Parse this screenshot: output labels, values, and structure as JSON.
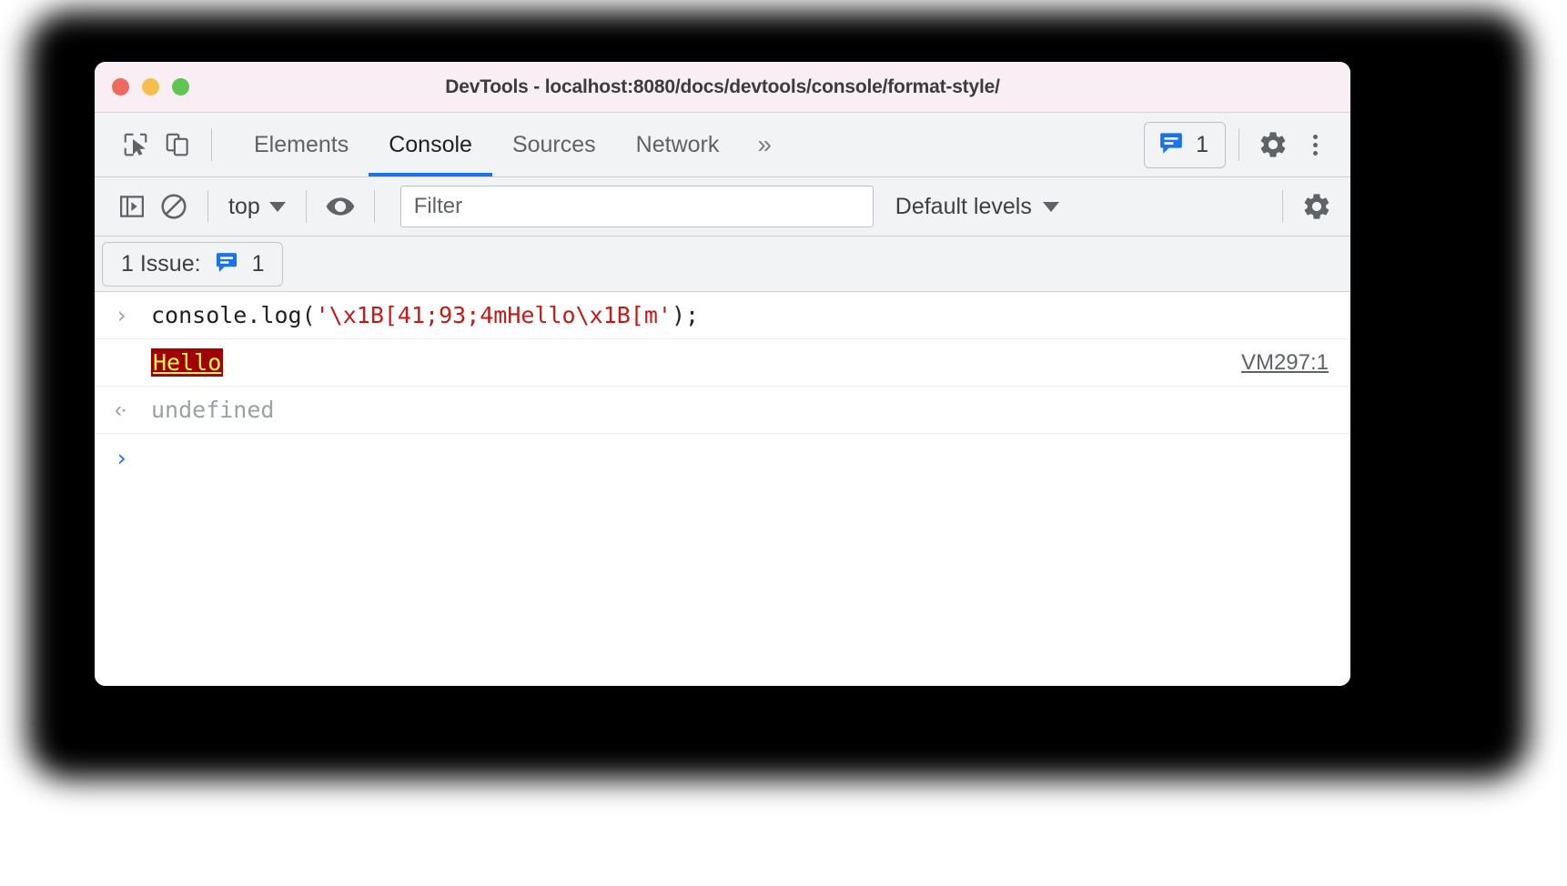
{
  "window": {
    "title": "DevTools - localhost:8080/docs/devtools/console/format-style/",
    "traffic_lights": [
      "close",
      "minimize",
      "zoom"
    ]
  },
  "tabbar": {
    "inspect_icon": "inspect-element-icon",
    "device_icon": "device-toolbar-icon",
    "tabs": [
      {
        "label": "Elements",
        "active": false
      },
      {
        "label": "Console",
        "active": true
      },
      {
        "label": "Sources",
        "active": false
      },
      {
        "label": "Network",
        "active": false
      }
    ],
    "more_tabs_label": "»",
    "issues_badge": {
      "icon": "issues-message-icon",
      "count": "1",
      "color": "#1a73e8"
    },
    "settings_icon": "gear-icon",
    "more_options_icon": "kebab-menu-icon"
  },
  "console_toolbar": {
    "sidebar_toggle_icon": "console-sidebar-icon",
    "clear_console_icon": "clear-console-icon",
    "context_selector": {
      "value": "top",
      "caret": "▼"
    },
    "live_expression_icon": "eye-icon",
    "filter": {
      "placeholder": "Filter",
      "value": ""
    },
    "log_levels": {
      "value": "Default levels",
      "caret": "▼"
    },
    "console_settings_icon": "gear-icon"
  },
  "issue_bar": {
    "label": "1 Issue:",
    "icon": "issues-message-icon",
    "count": "1"
  },
  "console": {
    "input_row": {
      "prompt": "›",
      "code_prefix": "console.log(",
      "code_string": "'\\x1B[41;93;4mHello\\x1B[m'",
      "code_suffix": ");"
    },
    "output_row": {
      "text": "Hello",
      "styles": {
        "background": "#a00000",
        "color": "#f8f845",
        "underline": true
      },
      "source_link": "VM297:1"
    },
    "result_row": {
      "arrow": "‹·",
      "value": "undefined"
    },
    "new_prompt": "›"
  }
}
